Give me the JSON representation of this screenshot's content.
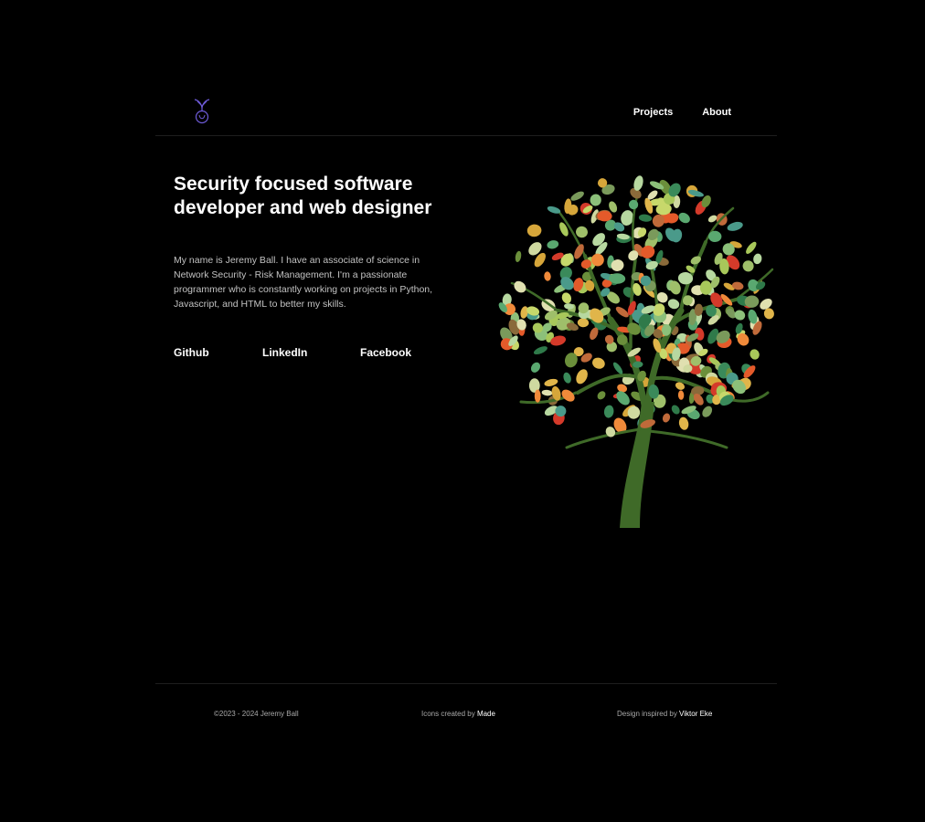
{
  "header": {
    "logo_icon": "sprout-icon",
    "nav": [
      {
        "label": "Projects"
      },
      {
        "label": "About"
      }
    ]
  },
  "hero": {
    "title_line1": "Security focused software",
    "title_line2": "developer and web designer",
    "description": "My name is Jeremy Ball. I have an associate of science in Network Security - Risk Management. I'm a passionate programmer who is constantly working on projects in Python, Javascript, and HTML to better my skills.",
    "links": {
      "github": "Github",
      "linkedin": "LinkedIn",
      "facebook": "Facebook"
    },
    "illustration": "leafy-tree"
  },
  "footer": {
    "copyright": "©2023 - 2024 Jeremy Ball",
    "icons_prefix": "Icons created by",
    "icons_link": "Made",
    "design_prefix": "Design inspired by",
    "design_link": "Viktor Eke"
  },
  "colors": {
    "background": "#000000",
    "text": "#ffffff",
    "muted_text": "#c2c2c2",
    "logo_accent": "#6e5bd8",
    "trunk": "#3f6a28"
  }
}
